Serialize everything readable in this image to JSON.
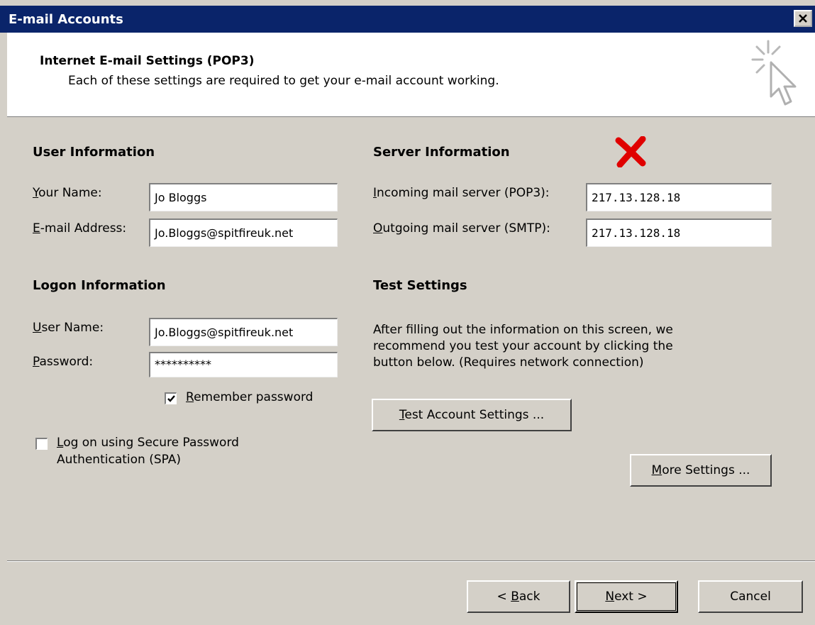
{
  "window": {
    "title": "E-mail Accounts",
    "close_icon": "close-icon"
  },
  "header": {
    "title": "Internet E-mail Settings (POP3)",
    "subtitle": "Each of these settings are required to get your e-mail account working.",
    "icon": "sparkle-cursor-icon"
  },
  "user_info": {
    "heading": "User Information",
    "name_label": "Your Name:",
    "name_value": "Jo Bloggs",
    "email_label": "E-mail Address:",
    "email_value": "Jo.Bloggs@spitfireuk.net"
  },
  "server_info": {
    "heading": "Server Information",
    "incoming_label": "Incoming mail server (POP3):",
    "incoming_value": "217.13.128.18",
    "outgoing_label": "Outgoing mail server (SMTP):",
    "outgoing_value": "217.13.128.18",
    "error_icon": "red-x-icon"
  },
  "logon_info": {
    "heading": "Logon Information",
    "user_label": "User Name:",
    "user_value": "Jo.Bloggs@spitfireuk.net",
    "password_label": "Password:",
    "password_value": "**********",
    "remember_label": "Remember password",
    "remember_checked": true,
    "spa_label_line1": "Log on using Secure Password",
    "spa_label_line2": "Authentication (SPA)",
    "spa_checked": false
  },
  "test_settings": {
    "heading": "Test Settings",
    "line1": "After filling out the information on this screen, we",
    "line2": "recommend you test your account by clicking the",
    "line3": "button below. (Requires network connection)",
    "test_button": "Test Account Settings ..."
  },
  "more_settings_button": "More Settings ...",
  "footer": {
    "back": "< Back",
    "next": "Next >",
    "cancel": "Cancel"
  },
  "colors": {
    "titlebar": "#0a246a",
    "dialog_bg": "#d4d0c8",
    "error_red": "#e00000"
  }
}
